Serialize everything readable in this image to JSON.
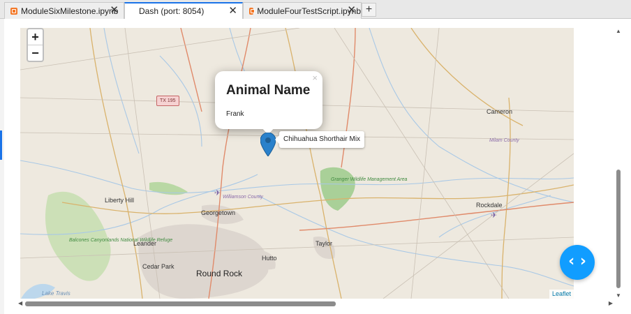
{
  "tabs": [
    {
      "label": "ModuleSixMilestone.ipynb",
      "close": "✕",
      "icon": "notebook-icon"
    },
    {
      "label": "Dash (port: 8054)",
      "close": "✕"
    },
    {
      "label": "ModuleFourTestScript.ipynb",
      "close": "✕",
      "icon": "notebook-icon"
    }
  ],
  "tab_add": "+",
  "map": {
    "zoom_in": "+",
    "zoom_out": "−",
    "popup": {
      "title": "Animal Name",
      "body": "Frank",
      "close": "×"
    },
    "tooltip": "Chihuahua Shorthair Mix",
    "attribution": "Leaflet",
    "labels": {
      "cameron": "Cameron",
      "milam_county": "Milam County",
      "tx195": "TX 195",
      "williamson_county": "Williamson County",
      "granger": "Granger Wildlife Management Area",
      "liberty_hill": "Liberty Hill",
      "georgetown": "Georgetown",
      "rockdale": "Rockdale",
      "balcones": "Balcones Canyonlands National Wildlife Refuge",
      "leander": "Leander",
      "taylor": "Taylor",
      "hutto": "Hutto",
      "cedar_park": "Cedar Park",
      "round_rock": "Round Rock",
      "lake_travis": "Lake Travis"
    }
  },
  "fab_symbol": "‹ ›",
  "colors": {
    "accent": "#1a73e8",
    "fab": "#119dff",
    "marker": "#2a81cb",
    "map_bg": "#eee9df",
    "notebook_icon": "#f37726"
  }
}
